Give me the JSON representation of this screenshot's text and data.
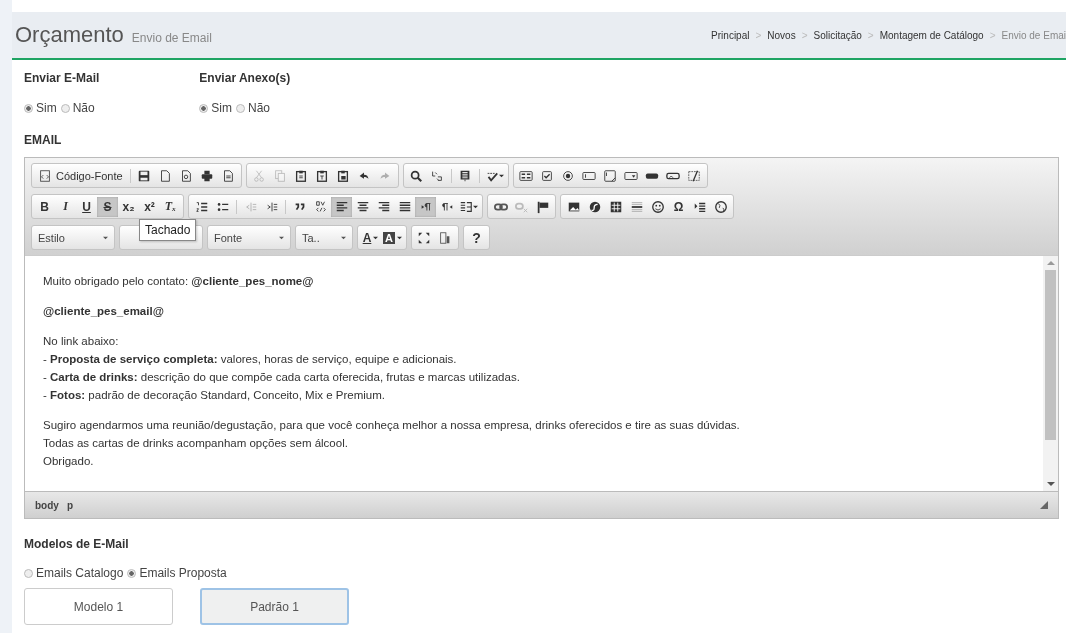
{
  "header": {
    "title": "Orçamento",
    "subtitle": "Envio de Email",
    "breadcrumb": [
      {
        "label": "Principal"
      },
      {
        "label": "Novos"
      },
      {
        "label": "Solicitação"
      },
      {
        "label": "Montagem de Catálogo"
      },
      {
        "label": "Envio de Emai"
      }
    ],
    "separator": ">"
  },
  "options": [
    {
      "label": "Enviar E-Mail",
      "choices": [
        {
          "label": "Sim",
          "selected": true
        },
        {
          "label": "Não",
          "selected": false
        }
      ]
    },
    {
      "label": "Enviar Anexo(s)",
      "choices": [
        {
          "label": "Sim",
          "selected": true
        },
        {
          "label": "Não",
          "selected": false
        }
      ]
    }
  ],
  "email_label": "EMAIL",
  "toolbar": [
    [
      [
        {
          "kind": "source",
          "label": "Código-Fonte"
        },
        {
          "kind": "sep"
        },
        {
          "kind": "save"
        },
        {
          "kind": "newpage"
        },
        {
          "kind": "preview"
        },
        {
          "kind": "print"
        },
        {
          "kind": "templates"
        }
      ],
      [
        {
          "kind": "cut",
          "disabled": true
        },
        {
          "kind": "copy",
          "disabled": true
        },
        {
          "kind": "paste"
        },
        {
          "kind": "pastetext"
        },
        {
          "kind": "pasteword"
        },
        {
          "kind": "undo"
        },
        {
          "kind": "redo",
          "disabled": true
        }
      ],
      [
        {
          "kind": "find"
        },
        {
          "kind": "replace"
        },
        {
          "kind": "sep"
        },
        {
          "kind": "selectall"
        },
        {
          "kind": "sep"
        },
        {
          "kind": "spellcheck"
        }
      ],
      [
        {
          "kind": "form"
        },
        {
          "kind": "checkbox"
        },
        {
          "kind": "radio"
        },
        {
          "kind": "textfield"
        },
        {
          "kind": "textarea"
        },
        {
          "kind": "select"
        },
        {
          "kind": "button"
        },
        {
          "kind": "imagebutton"
        },
        {
          "kind": "hidden"
        }
      ]
    ],
    [
      [
        {
          "kind": "bold",
          "glyph": "B"
        },
        {
          "kind": "italic",
          "glyph": "I"
        },
        {
          "kind": "underline",
          "glyph": "U"
        },
        {
          "kind": "strike",
          "glyph": "S",
          "on": true
        },
        {
          "kind": "subscript",
          "glyph": "x₂"
        },
        {
          "kind": "superscript",
          "glyph": "x²"
        },
        {
          "kind": "clearformat",
          "glyph": "Tₓ"
        }
      ],
      [
        {
          "kind": "numlist"
        },
        {
          "kind": "bullist"
        },
        {
          "kind": "sep"
        },
        {
          "kind": "outdent",
          "disabled": true
        },
        {
          "kind": "indent"
        },
        {
          "kind": "sep"
        },
        {
          "kind": "blockquote"
        },
        {
          "kind": "creatediv"
        },
        {
          "kind": "alignleft",
          "on": true
        },
        {
          "kind": "aligncenter"
        },
        {
          "kind": "alignright"
        },
        {
          "kind": "justify"
        },
        {
          "kind": "ltr",
          "on": true
        },
        {
          "kind": "rtl"
        },
        {
          "kind": "language"
        }
      ],
      [
        {
          "kind": "link"
        },
        {
          "kind": "unlink",
          "disabled": true
        },
        {
          "kind": "anchor"
        }
      ],
      [
        {
          "kind": "image"
        },
        {
          "kind": "flash"
        },
        {
          "kind": "table"
        },
        {
          "kind": "hr"
        },
        {
          "kind": "smiley"
        },
        {
          "kind": "specialchar",
          "glyph": "Ω"
        },
        {
          "kind": "pagebreak"
        },
        {
          "kind": "iframe"
        }
      ]
    ]
  ],
  "combos": [
    {
      "kind": "dropdown",
      "label": "Estilo"
    },
    {
      "kind": "dropdown"
    },
    {
      "kind": "dropdown",
      "label": "Fonte"
    },
    {
      "kind": "dropdown",
      "label": "Ta.."
    }
  ],
  "color_buttons": [
    {
      "glyph": "A",
      "kind": "text"
    },
    {
      "glyph": "A",
      "kind": "background"
    }
  ],
  "help": "?",
  "tooltip": "Tachado",
  "content": [
    [
      "Muito obrigado pelo contato:  **@cliente_pes_nome@**"
    ],
    [
      "**@cliente_pes_email@**"
    ],
    [
      "No link abaixo:",
      "- **Proposta de serviço completa:** valores, horas de serviço, equipe e adicionais.",
      "- **Carta de drinks:** descrição do que compõe cada carta oferecida, frutas e marcas utilizadas.",
      "- **Fotos:** padrão de decoração Standard, Conceito, Mix e Premium."
    ],
    [
      "Sugiro agendarmos uma reunião/degustação, para que você conheça melhor a nossa empresa, drinks oferecidos e tire as suas dúvidas.",
      "Todas as cartas de drinks acompanham opções sem álcool.",
      "Obrigado."
    ]
  ],
  "path": [
    "body",
    "p"
  ],
  "templates": {
    "label": "Modelos de E-Mail",
    "choices": [
      {
        "label": "Emails Catalogo",
        "selected": false
      },
      {
        "label": "Emails Proposta",
        "selected": true
      }
    ],
    "buttons": [
      {
        "label": "Modelo 1",
        "selected": false
      },
      {
        "label": "Padrão 1",
        "selected": true
      }
    ]
  }
}
